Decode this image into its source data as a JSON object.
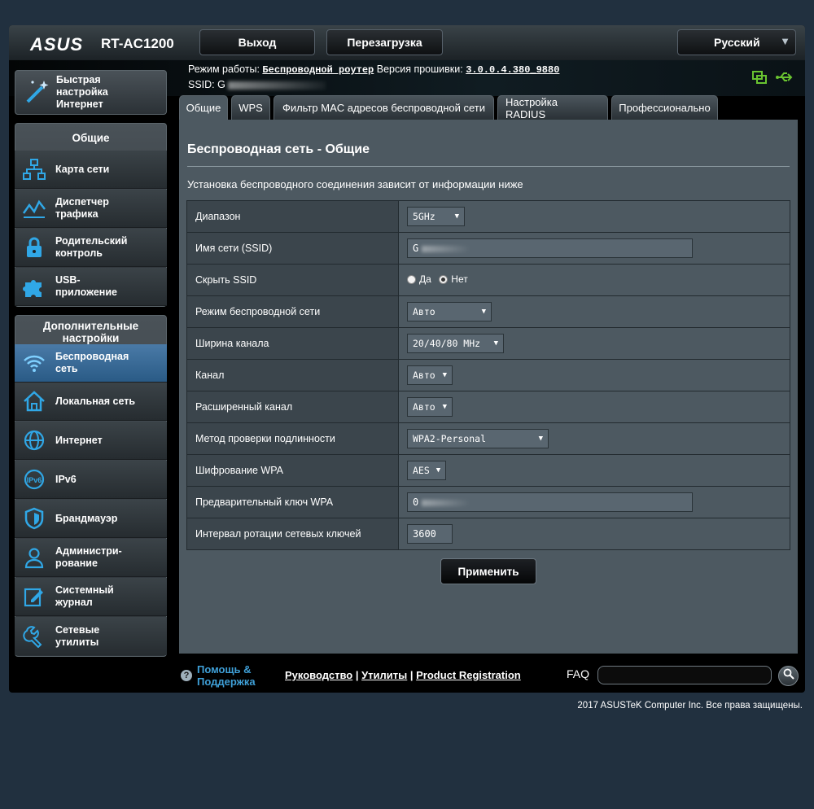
{
  "header": {
    "logo": "ASUS",
    "model": "RT-AC1200",
    "logout_label": "Выход",
    "reboot_label": "Перезагрузка",
    "language": "Русский"
  },
  "infobar": {
    "mode_label": "Режим работы:",
    "mode_value": "Беспроводной роутер",
    "firmware_label": "Версия прошивки:",
    "firmware_value": "3.0.0.4.380_9880",
    "ssid_label": "SSID:",
    "ssid_value": "G"
  },
  "sidebar": {
    "quick_setup": "Быстрая\nнастройка\nИнтернет",
    "general_header": "Общие",
    "general_items": [
      {
        "label": "Карта сети",
        "icon": "network-map-icon"
      },
      {
        "label": "Диспетчер\nтрафика",
        "icon": "traffic-manager-icon"
      },
      {
        "label": "Родительский\nконтроль",
        "icon": "parental-control-icon"
      },
      {
        "label": "USB-\nприложение",
        "icon": "usb-app-icon"
      }
    ],
    "advanced_header": "Дополнительные\nнастройки",
    "advanced_items": [
      {
        "label": "Беспроводная\nсеть",
        "icon": "wireless-icon",
        "active": true
      },
      {
        "label": "Локальная сеть",
        "icon": "lan-icon"
      },
      {
        "label": "Интернет",
        "icon": "internet-icon"
      },
      {
        "label": "IPv6",
        "icon": "ipv6-icon"
      },
      {
        "label": "Брандмауэр",
        "icon": "firewall-icon"
      },
      {
        "label": "Администри-\nрование",
        "icon": "administration-icon"
      },
      {
        "label": "Системный\nжурнал",
        "icon": "system-log-icon"
      },
      {
        "label": "Сетевые\nутилиты",
        "icon": "network-tools-icon"
      }
    ]
  },
  "tabs": [
    {
      "label": "Общие",
      "active": true
    },
    {
      "label": "WPS"
    },
    {
      "label": "Фильтр MAC адресов беспроводной сети"
    },
    {
      "label": "Настройка RADIUS"
    },
    {
      "label": "Профессионально"
    }
  ],
  "panel": {
    "title": "Беспроводная сеть - Общие",
    "description": "Установка беспроводного соединения зависит от информации ниже",
    "apply_label": "Применить"
  },
  "settings": {
    "band": {
      "label": "Диапазон",
      "value": "5GHz"
    },
    "ssid": {
      "label": "Имя сети (SSID)",
      "value": "G"
    },
    "hide_ssid": {
      "label": "Скрыть SSID",
      "yes": "Да",
      "no": "Нет",
      "selected": "no"
    },
    "wireless_mode": {
      "label": "Режим беспроводной сети",
      "value": "Авто"
    },
    "channel_width": {
      "label": "Ширина канала",
      "value": "20/40/80 MHz"
    },
    "channel": {
      "label": "Канал",
      "value": "Авто"
    },
    "ext_channel": {
      "label": "Расширенный канал",
      "value": "Авто"
    },
    "auth_method": {
      "label": "Метод проверки подлинности",
      "value": "WPA2-Personal"
    },
    "wpa_encryption": {
      "label": "Шифрование WPA",
      "value": "AES"
    },
    "wpa_key": {
      "label": "Предварительный ключ WPA",
      "value": "0"
    },
    "key_rotation": {
      "label": "Интервал ротации сетевых ключей",
      "value": "3600"
    }
  },
  "footer": {
    "help": "Помощь &\nПоддержка",
    "manual": "Руководство",
    "utilities": "Утилиты",
    "registration": "Product Registration",
    "faq": "FAQ",
    "copyright": "2017 ASUSTeK Computer Inc. Все права защищены."
  },
  "colors": {
    "background": "#21303f",
    "panel": "#4d5961",
    "accent_blue": "#30a7e6",
    "status_green": "#69c330"
  }
}
